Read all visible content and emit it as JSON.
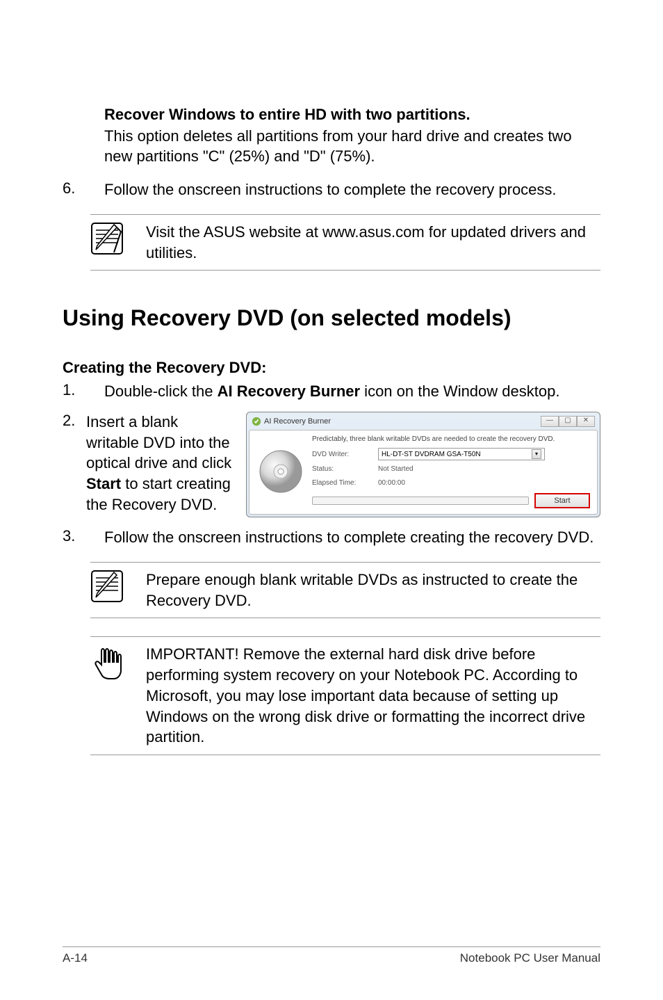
{
  "section1": {
    "title": "Recover Windows to entire HD with two partitions.",
    "desc": "This option deletes all partitions from your hard drive and creates two new partitions \"C\" (25%) and \"D\" (75%)."
  },
  "step6": {
    "num": "6.",
    "text": "Follow the onscreen instructions to complete the recovery process."
  },
  "note1": "Visit the ASUS website at www.asus.com for updated drivers and utilities.",
  "heading2": "Using Recovery DVD (on selected models)",
  "subheading": "Creating the Recovery DVD:",
  "step1": {
    "num": "1.",
    "prefix": "Double-click the ",
    "bold": "AI Recovery Burner",
    "suffix": " icon on the Window desktop."
  },
  "step2": {
    "num": "2.",
    "prefix": "Insert a blank writable DVD into the optical drive and click ",
    "bold": "Start",
    "suffix": " to start creating the Recovery DVD."
  },
  "burner": {
    "title": "AI Recovery Burner",
    "min": "—",
    "max": "▢",
    "close": "✕",
    "predict": "Predictably, three blank writable DVDs are needed to create the recovery DVD.",
    "writer_label": "DVD Writer:",
    "writer_value": "HL-DT-ST DVDRAM GSA-T50N",
    "status_label": "Status:",
    "status_value": "Not Started",
    "elapsed_label": "Elapsed Time:",
    "elapsed_value": "00:00:00",
    "start": "Start"
  },
  "step3": {
    "num": "3.",
    "text": "Follow the onscreen instructions to complete creating the recovery DVD."
  },
  "note2": "Prepare enough blank writable DVDs as instructed to create the Recovery DVD.",
  "important": "IMPORTANT! Remove the external hard disk drive before performing system recovery on your Notebook PC. According to Microsoft, you may lose important data because of setting up Windows on the wrong disk drive or formatting the incorrect drive partition.",
  "footer": {
    "page": "A-14",
    "label": "Notebook PC User Manual"
  }
}
